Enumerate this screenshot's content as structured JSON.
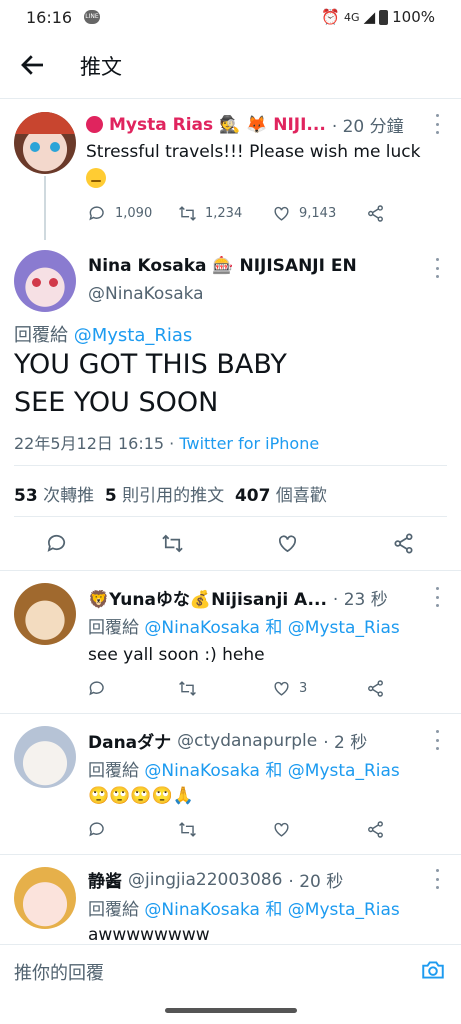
{
  "status_bar": {
    "time": "16:16",
    "network": "4G",
    "battery": "100%"
  },
  "header": {
    "title": "推文"
  },
  "parent_tweet": {
    "name": "Mysta Rias 🕵 🦊 NIJI...",
    "time": "· 20 分鐘",
    "text": "Stressful travels!!! Please wish me luck",
    "replies": "1,090",
    "retweets": "1,234",
    "likes": "9,143"
  },
  "main_tweet": {
    "name": "Nina Kosaka 🎰 NIJISANJI EN",
    "handle": "@NinaKosaka",
    "reply_to_label": "回覆給",
    "reply_to": "@Mysta_Rias",
    "line1": "YOU GOT THIS BABY",
    "line2": "SEE YOU SOON",
    "datetime": "22年5月12日 16:15 ·",
    "client": "Twitter for iPhone",
    "retweets_count": "53",
    "retweets_label": "次轉推",
    "quotes_count": "5",
    "quotes_label": "則引用的推文",
    "likes_count": "407",
    "likes_label": "個喜歡"
  },
  "replies": [
    {
      "name": "🦁Yunaゆな💰Nijisanji A...",
      "handle": "",
      "time": "· 23 秒",
      "reply_label": "回覆給",
      "reply_to": "@NinaKosaka 和 @Mysta_Rias",
      "text": "see  yall soon :) hehe",
      "likes": "3"
    },
    {
      "name": "Danaダナ",
      "handle": "@ctydanapurple",
      "time": "· 2 秒",
      "reply_label": "回覆給",
      "reply_to": "@NinaKosaka 和 @Mysta_Rias",
      "text": "🙄🙄🙄🙄🙏",
      "likes": ""
    },
    {
      "name": "静酱",
      "handle": "@jingjia22003086",
      "time": "· 20 秒",
      "reply_label": "回覆給",
      "reply_to": "@NinaKosaka 和 @Mysta_Rias",
      "text": "awwwwwwww",
      "likes": ""
    }
  ],
  "composer": {
    "placeholder": "推你的回覆"
  },
  "colors": {
    "accent": "#1d9bf0",
    "muted": "#536471",
    "mysta_name": "#e0245e"
  }
}
